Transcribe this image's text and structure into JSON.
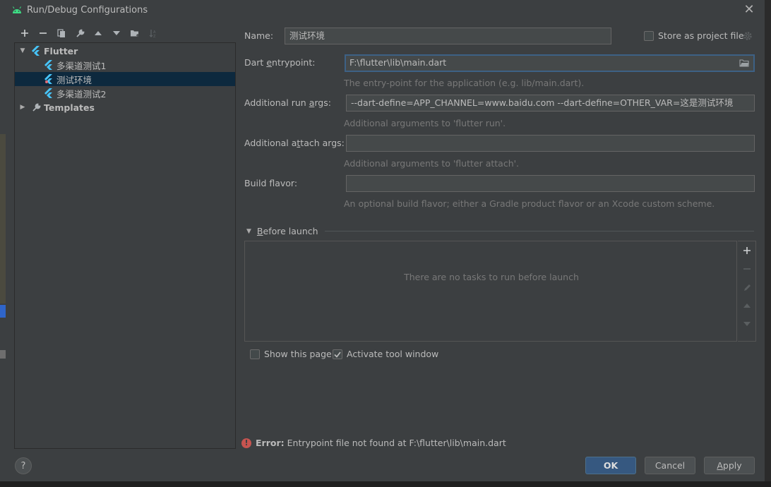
{
  "window": {
    "title": "Run/Debug Configurations",
    "close": "✕"
  },
  "toolbar": {
    "buttons": [
      "add",
      "remove",
      "copy",
      "edit-defaults",
      "move-up",
      "move-down",
      "new-folder",
      "sort"
    ]
  },
  "tree": {
    "flutter_group": "Flutter",
    "items": [
      "多渠道测试1",
      "测试环境",
      "多渠道测试2"
    ],
    "selected_index": 1,
    "templates": "Templates"
  },
  "form": {
    "name_label": "Name:",
    "name_value": "测试环境",
    "store_label": "Store as project file",
    "entrypoint_label_pre": "Dart ",
    "entrypoint_label_u": "e",
    "entrypoint_label_post": "ntrypoint:",
    "entrypoint_value": "F:\\flutter\\lib\\main.dart",
    "entrypoint_hint": "The entry-point for the application (e.g. lib/main.dart).",
    "run_args_label_pre": "Additional run ",
    "run_args_label_u": "a",
    "run_args_label_post": "rgs:",
    "run_args_value": "--dart-define=APP_CHANNEL=www.baidu.com --dart-define=OTHER_VAR=这是测试环境",
    "run_args_hint": "Additional arguments to 'flutter run'.",
    "attach_args_label_pre": "Additional a",
    "attach_args_label_u": "t",
    "attach_args_label_post": "tach args:",
    "attach_args_value": "",
    "attach_args_hint": "Additional arguments to 'flutter attach'.",
    "flavor_label": "Build flavor:",
    "flavor_value": "",
    "flavor_hint": "An optional build flavor; either a Gradle product flavor or an Xcode custom scheme."
  },
  "before_launch": {
    "title_u": "B",
    "title_rest": "efore launch",
    "empty_text": "There are no tasks to run before launch",
    "show_page_label": "Show this page",
    "show_page_checked": false,
    "activate_label": "Activate tool window",
    "activate_checked": true
  },
  "error": {
    "label": "Error:",
    "message": "Entrypoint file not found at F:\\flutter\\lib\\main.dart"
  },
  "buttons": {
    "help": "?",
    "ok": "OK",
    "cancel": "Cancel",
    "apply_u": "A",
    "apply_rest": "pply"
  },
  "colors": {
    "dialog_bg": "#3c3f41",
    "selection": "#0d293e",
    "primary_button": "#365880",
    "error": "#c75450",
    "flutter_blue": "#47c5fb"
  }
}
